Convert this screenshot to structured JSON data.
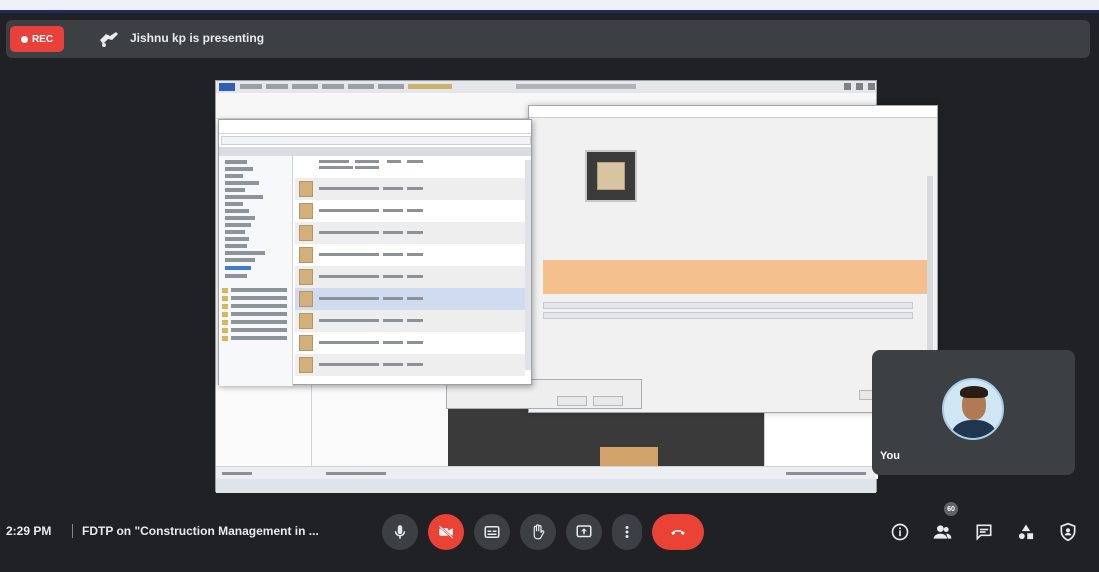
{
  "recording": {
    "label": "REC"
  },
  "presenter": {
    "text": "Jishnu kp is presenting"
  },
  "meeting": {
    "time": "2:29 PM",
    "title": "FDTP on \"Construction Management in ..."
  },
  "self_view": {
    "name": "You"
  },
  "participants": {
    "count": "60"
  },
  "controls": {
    "mic": "mic-icon",
    "camera_off": "camera-off-icon",
    "captions": "captions-icon",
    "raise_hand": "hand-icon",
    "present": "present-screen-icon",
    "more": "more-vert-icon",
    "leave": "call-end-icon"
  },
  "side_controls": [
    "info-icon",
    "people-icon",
    "chat-icon",
    "activities-icon",
    "host-controls-icon"
  ],
  "colors": {
    "background": "#202124",
    "surface": "#3c4043",
    "danger": "#ea4335",
    "text": "#e8eaed"
  }
}
